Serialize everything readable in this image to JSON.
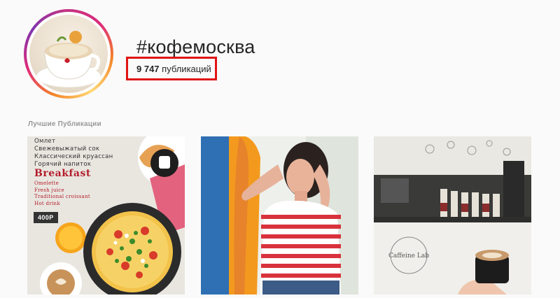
{
  "header": {
    "hashtag": "#кофемосква",
    "post_count_number": "9 747",
    "post_count_label": "публикаций",
    "highlight_color": "#e01515"
  },
  "section": {
    "title": "Лучшие Публикации"
  },
  "posts": [
    {
      "menu_ru": [
        "Омлет",
        "Свежевыжатый сок",
        "Классический круассан",
        "Горячий напиток"
      ],
      "menu_title": "Breakfast",
      "menu_en": [
        "Omelette",
        "Fresh juice",
        "Traditional croissant",
        "Hot drink"
      ],
      "price": "400Р"
    },
    {},
    {
      "sign_text": "Caffeine Lab"
    }
  ],
  "colors": {
    "background": "#fafafa",
    "text": "#262626",
    "muted": "#999999",
    "accent_red": "#b31e2b"
  }
}
